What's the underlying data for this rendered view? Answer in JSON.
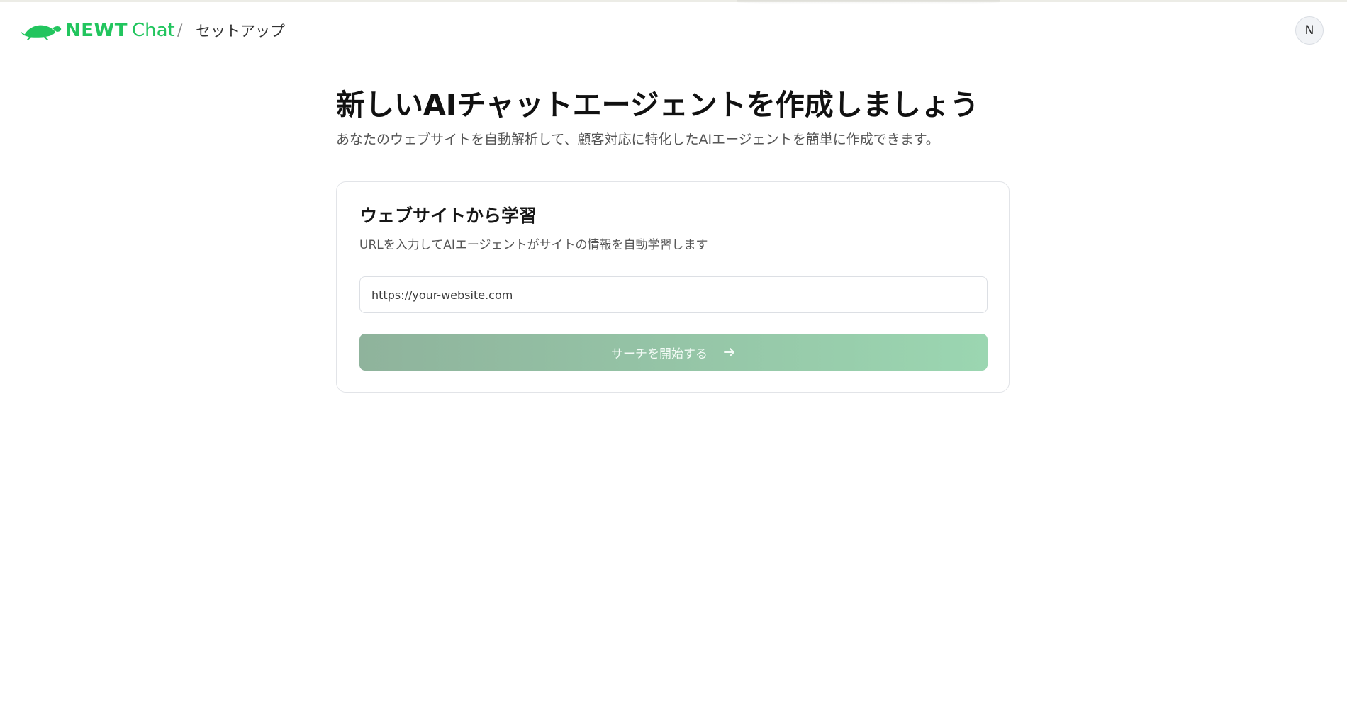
{
  "header": {
    "logo": {
      "strong": "NEWT",
      "light": "Chat",
      "icon": "turtle-logo-icon",
      "color": "#22c55e"
    },
    "breadcrumb_separator": "/",
    "breadcrumb_current": "セットアップ",
    "avatar_initial": "N"
  },
  "main": {
    "title": "新しいAIチャットエージェントを作成しましょう",
    "subtitle": "あなたのウェブサイトを自動解析して、顧客対応に特化したAIエージェントを簡単に作成できます。",
    "card": {
      "title": "ウェブサイトから学習",
      "description": "URLを入力してAIエージェントがサイトの情報を自動学習します",
      "url_input": {
        "value": "",
        "placeholder": "https://your-website.com"
      },
      "start_button": {
        "label": "サーチを開始する",
        "icon": "arrow-right-icon",
        "gradient": [
          "#8fb39c",
          "#9bd6b1"
        ]
      }
    }
  }
}
